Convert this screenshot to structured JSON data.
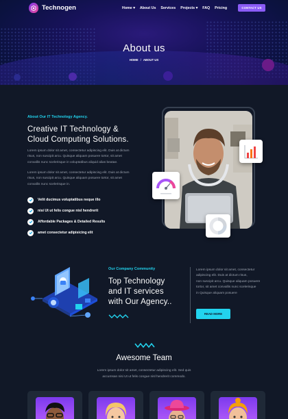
{
  "brand": {
    "name": "Technogen"
  },
  "nav": {
    "items": [
      "Home",
      "About Us",
      "Services",
      "Projects",
      "FAQ",
      "Pricing"
    ],
    "dropdown_flags": [
      true,
      false,
      false,
      true,
      false,
      false
    ],
    "cta": "CONTACT US"
  },
  "hero": {
    "title": "About us",
    "breadcrumb": [
      "HOME",
      "ABOUT US"
    ]
  },
  "about": {
    "eyebrow": "About Our IT Technology Agency.",
    "heading": [
      "Creative IT Technology &",
      "Cloud Computing Solutions."
    ],
    "para1": [
      "Lorem ipsum dolor sit amet, consectetur adipiscing elit. Duis at dictum",
      "risus, non suscipit arcu. Quisque aliquam posuere tortor, sit amet",
      "convallis nunc scelerisque in voluptatibus aliquid alias beatae."
    ],
    "para2": [
      "Lorem ipsum dolor sit amet, consectetur adipiscing elit. Duis at dictum",
      "risus, non suscipit arcu. Quisque aliquam posuere tortor, sit amet",
      "convallis nunc scelerisque in."
    ],
    "checks": [
      "Velit ducimus voluptatibus neque illo",
      "nisi Ut ut felis congue nisl hendrerit",
      "Affordable Packages & Detailed Results",
      "amet consectetur adipisicing elit"
    ]
  },
  "community": {
    "eyebrow": "Our Company Community",
    "heading": [
      "Top Technology",
      "and IT services",
      "with Our Agency.."
    ],
    "para": [
      "Lorem ipsum dolor sit amet, consectetur",
      "adipiscing elit. Duis at dictum risus,",
      "non suscipit arcu. Quisque aliquam posuere",
      "tortor, sit amet convallis nunc scelerisque",
      "in Quisque aliquam posuere"
    ],
    "button": "READ MORE"
  },
  "team": {
    "title": "Awesome Team",
    "subtitle": [
      "Lorem ipsum dolor sit amet, consectetur adipiscing elit. Sed quis",
      "accumsan nisi Ut ut felis congue nisl hendrerit commodo."
    ]
  },
  "colors": {
    "accent": "#22d3ee",
    "purple": "#8b5cf6",
    "bg": "#111827",
    "hero": "#17125a"
  },
  "icons": [
    "logo-icon",
    "check-icon",
    "zigzag-icon",
    "gauge-icon",
    "bar-chart-icon",
    "donut-icon",
    "laptop-isometric-icon"
  ]
}
